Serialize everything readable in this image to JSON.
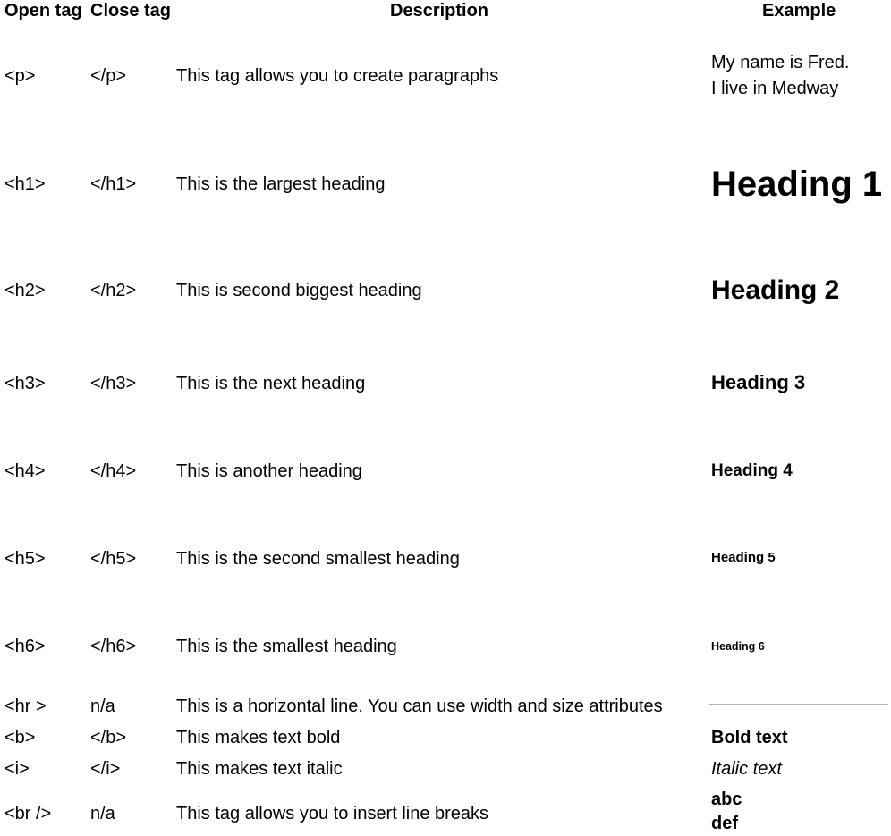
{
  "headers": {
    "open": "Open tag",
    "close": "Close tag",
    "description": "Description",
    "example": "Example"
  },
  "rows": [
    {
      "open": "<p>",
      "close": "</p>",
      "description": "This tag allows you to create paragraphs",
      "example_line1": "My name is Fred.",
      "example_line2": "I live in Medway"
    },
    {
      "open": "<h1>",
      "close": "</h1>",
      "description": "This is the largest heading",
      "example": "Heading 1"
    },
    {
      "open": "<h2>",
      "close": "</h2>",
      "description": "This is second biggest heading",
      "example": "Heading 2"
    },
    {
      "open": "<h3>",
      "close": "</h3>",
      "description": "This is the next heading",
      "example": "Heading 3"
    },
    {
      "open": "<h4>",
      "close": "</h4>",
      "description": "This is another heading",
      "example": "Heading 4"
    },
    {
      "open": "<h5>",
      "close": "</h5>",
      "description": "This is the second smallest heading",
      "example": "Heading 5"
    },
    {
      "open": "<h6>",
      "close": "</h6>",
      "description": "This is the smallest heading",
      "example": "Heading 6"
    },
    {
      "open": "<hr >",
      "close": "n/a",
      "description": "This is a horizontal line. You can use width and size attributes"
    },
    {
      "open": "<b>",
      "close": "</b>",
      "description": "This makes text bold",
      "example": "Bold text"
    },
    {
      "open": "<i>",
      "close": "</i>",
      "description": "This makes text italic",
      "example": "Italic text"
    },
    {
      "open": "<br />",
      "close": "n/a",
      "description": "This tag allows you to insert line breaks",
      "example_line1": "abc",
      "example_line2": "def"
    }
  ]
}
